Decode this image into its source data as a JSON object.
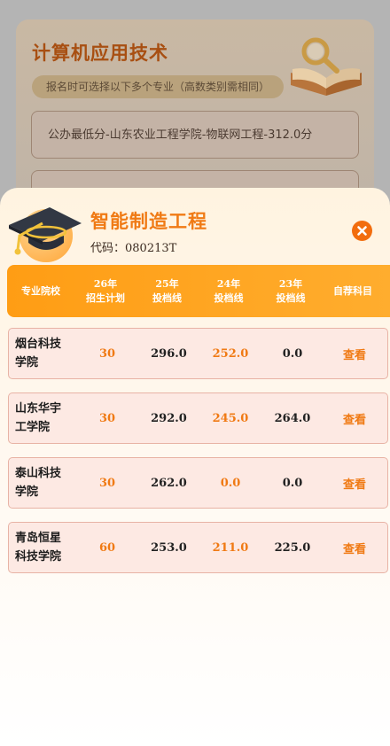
{
  "background": {
    "title": "计算机应用技术",
    "subtitle": "报名时可选择以下多个专业（高数类别需相同）",
    "min_score_text": "公办最低分-山东农业工程学院-物联网工程-312.0分"
  },
  "modal": {
    "major_name": "智能制造工程",
    "code_label": "代码：",
    "code_value": "080213T",
    "close_icon": "close-x-icon",
    "accent_color": "#f07a14"
  },
  "table": {
    "headers": [
      {
        "line1": "专业院校",
        "line2": ""
      },
      {
        "line1": "26年",
        "line2": "招生计划"
      },
      {
        "line1": "25年",
        "line2": "投档线"
      },
      {
        "line1": "24年",
        "line2": "投档线"
      },
      {
        "line1": "23年",
        "line2": "投档线"
      },
      {
        "line1": "自荐科目",
        "line2": ""
      }
    ],
    "rows": [
      {
        "school_line1": "烟台科技",
        "school_line2": "学院",
        "plan26": "30",
        "score25": "296.0",
        "score24": "252.0",
        "score23": "0.0",
        "action": "查看"
      },
      {
        "school_line1": "山东华宇",
        "school_line2": "工学院",
        "plan26": "30",
        "score25": "292.0",
        "score24": "245.0",
        "score23": "264.0",
        "action": "查看"
      },
      {
        "school_line1": "泰山科技",
        "school_line2": "学院",
        "plan26": "30",
        "score25": "262.0",
        "score24": "0.0",
        "score23": "0.0",
        "action": "查看"
      },
      {
        "school_line1": "青岛恒星",
        "school_line2": "科技学院",
        "plan26": "60",
        "score25": "253.0",
        "score24": "211.0",
        "score23": "225.0",
        "action": "查看"
      }
    ]
  }
}
